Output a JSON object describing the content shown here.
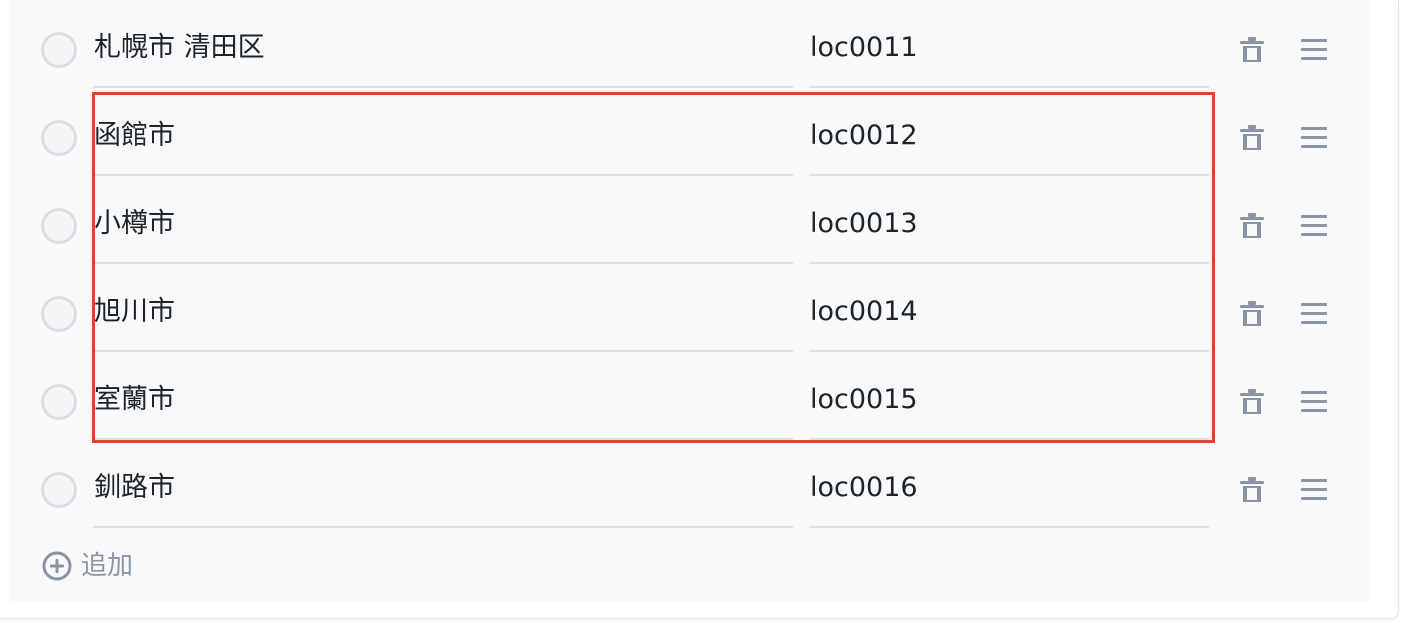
{
  "list": {
    "rows": [
      {
        "name": "札幌市 清田区",
        "code": "loc0011"
      },
      {
        "name": "函館市",
        "code": "loc0012"
      },
      {
        "name": "小樽市",
        "code": "loc0013"
      },
      {
        "name": "旭川市",
        "code": "loc0014"
      },
      {
        "name": "室蘭市",
        "code": "loc0015"
      },
      {
        "name": "釧路市",
        "code": "loc0016"
      }
    ],
    "add_label": "追加"
  },
  "colors": {
    "highlight": "#e0442f",
    "icon": "#8a94a3",
    "text": "#1f2328",
    "panel_bg": "#f8f9fb"
  },
  "icons": {
    "delete": "trash-icon",
    "reorder": "drag-handle-icon",
    "add": "plus-circle-icon"
  }
}
